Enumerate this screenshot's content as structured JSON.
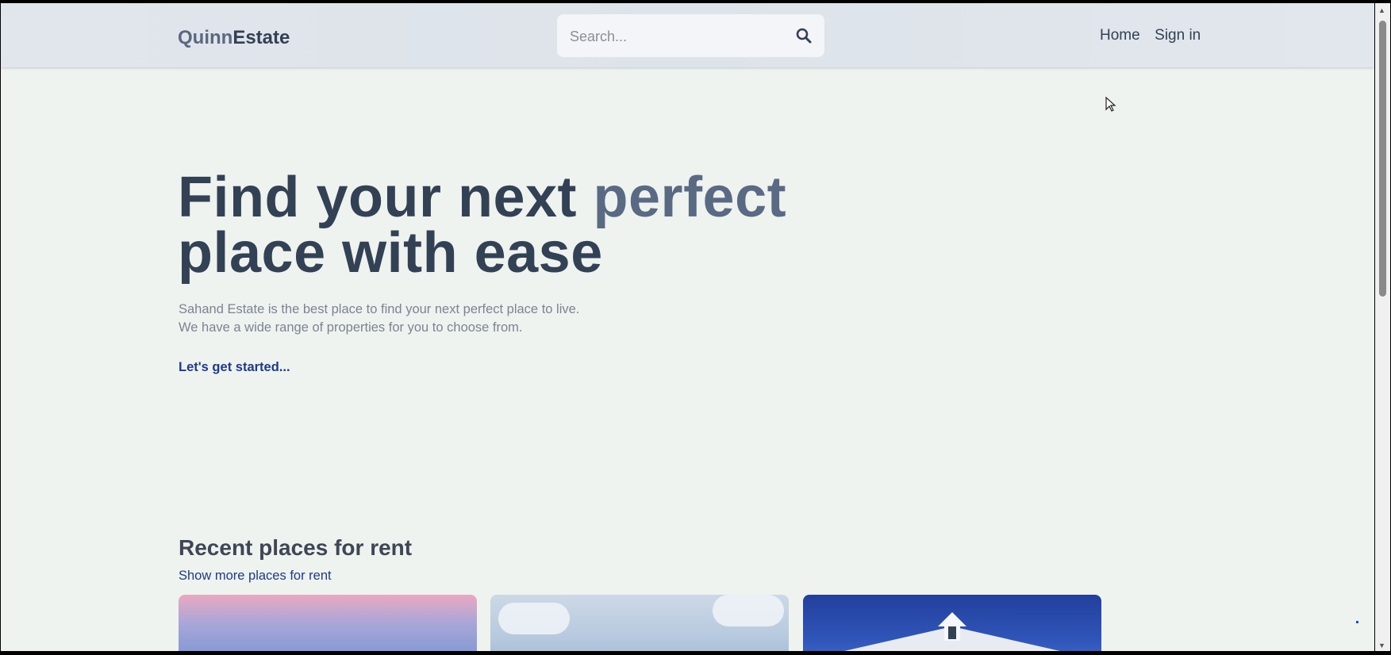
{
  "header": {
    "logo_part1": "Quinn",
    "logo_part2": "Estate",
    "search_placeholder": "Search...",
    "nav": [
      "Home",
      "Sign in"
    ]
  },
  "hero": {
    "title_part1": "Find your next ",
    "title_highlight": "perfect",
    "title_part2": "place with ease",
    "subtitle_line1": "Sahand Estate is the best place to find your next perfect place to live.",
    "subtitle_line2": "We have a wide range of properties for you to choose from.",
    "cta": "Let's get started..."
  },
  "recent": {
    "heading": "Recent places for rent",
    "more_link": "Show more places for rent"
  },
  "colors": {
    "background": "#eff3f0",
    "text_dark": "#334155",
    "highlight": "#5b6a83",
    "link": "#1e3a8a"
  },
  "icons": [
    "search-icon",
    "cursor-icon",
    "scroll-up-icon",
    "scroll-down-icon"
  ]
}
